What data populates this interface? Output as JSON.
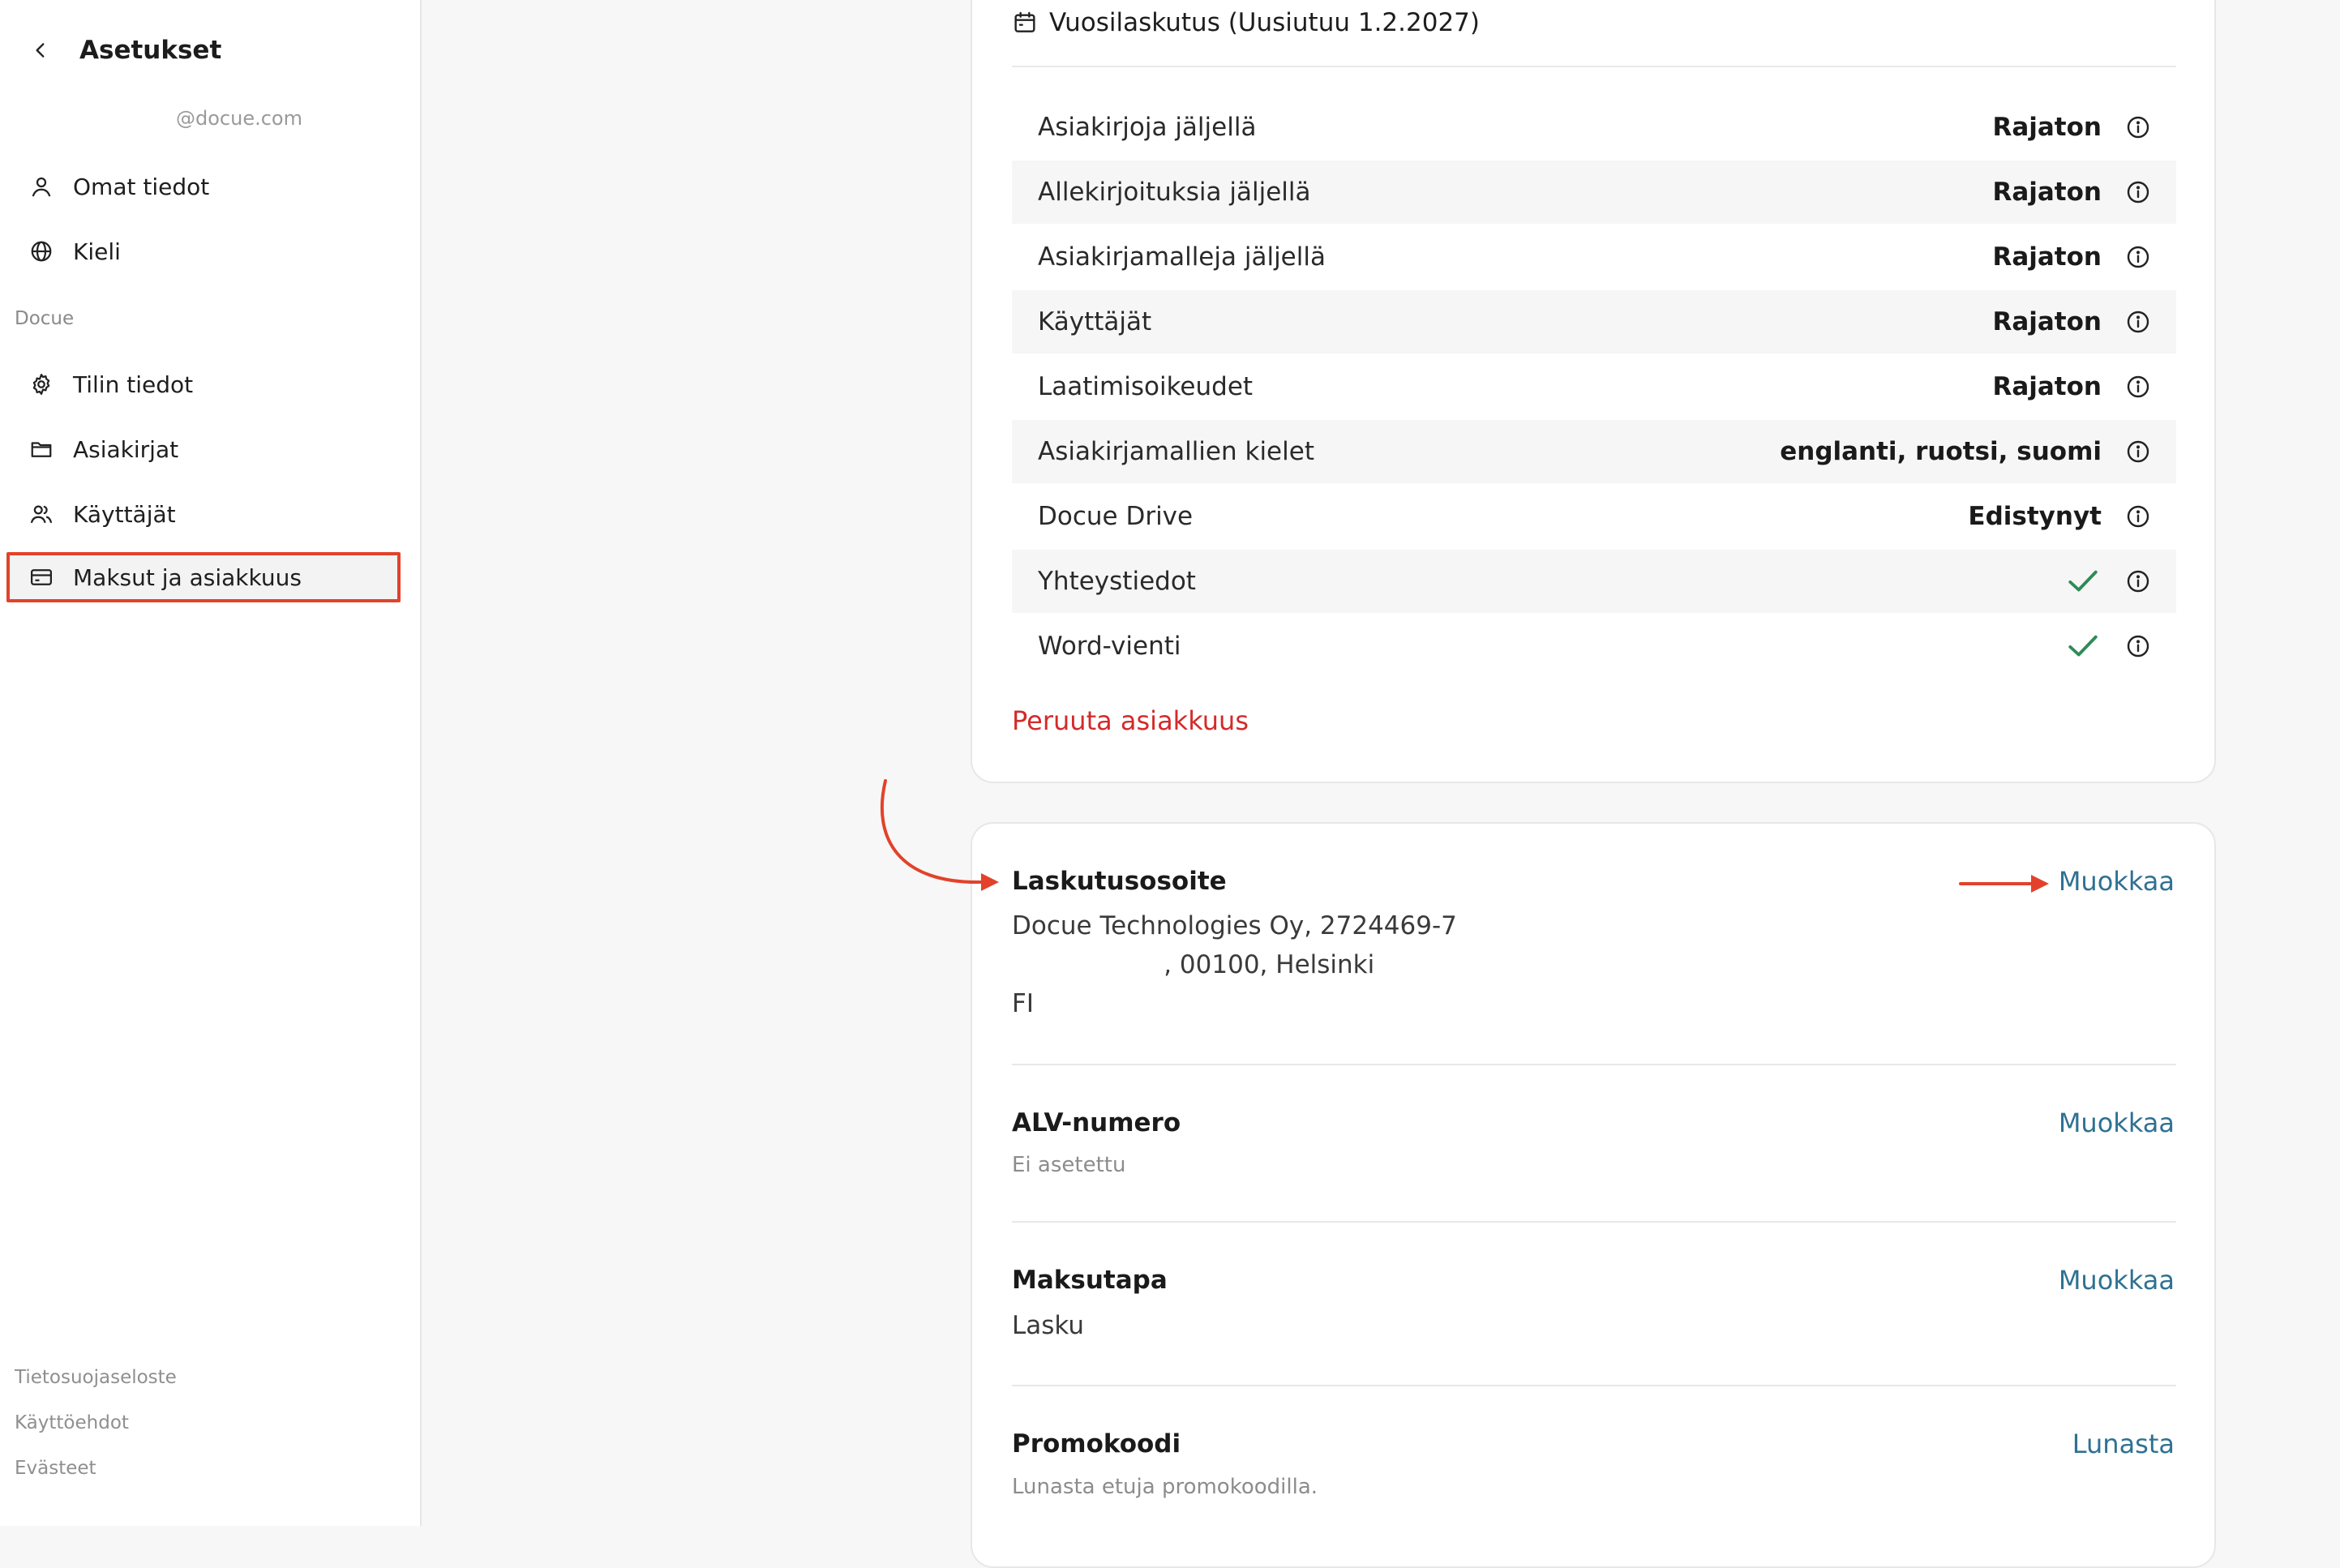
{
  "sidebar": {
    "title": "Asetukset",
    "email": "@docue.com",
    "personal_items": [
      {
        "label": "Omat tiedot",
        "icon": "user-icon"
      },
      {
        "label": "Kieli",
        "icon": "globe-icon"
      }
    ],
    "section_label": "Docue",
    "org_items": [
      {
        "label": "Tilin tiedot",
        "icon": "gear-icon"
      },
      {
        "label": "Asiakirjat",
        "icon": "folder-icon"
      },
      {
        "label": "Käyttäjät",
        "icon": "users-icon"
      },
      {
        "label": "Maksut ja asiakkuus",
        "icon": "credit-card-icon",
        "active": true
      }
    ],
    "footer_links": [
      "Tietosuojaseloste",
      "Käyttöehdot",
      "Evästeet"
    ]
  },
  "plan": {
    "billing_label": "Vuosilaskutus (Uusiutuu 1.2.2027)",
    "features": [
      {
        "name": "Asiakirjoja jäljellä",
        "value": "Rajaton"
      },
      {
        "name": "Allekirjoituksia jäljellä",
        "value": "Rajaton"
      },
      {
        "name": "Asiakirjamalleja jäljellä",
        "value": "Rajaton"
      },
      {
        "name": "Käyttäjät",
        "value": "Rajaton"
      },
      {
        "name": "Laatimisoikeudet",
        "value": "Rajaton"
      },
      {
        "name": "Asiakirjamallien kielet",
        "value": "englanti, ruotsi, suomi"
      },
      {
        "name": "Docue Drive",
        "value": "Edistynyt"
      },
      {
        "name": "Yhteystiedot",
        "value": "included"
      },
      {
        "name": "Word-vienti",
        "value": "included"
      }
    ],
    "cancel_label": "Peruuta asiakkuus"
  },
  "billing": {
    "address": {
      "title": "Laskutusosoite",
      "line1": "Docue Technologies Oy, 2724469-7",
      "line2": "                   , 00100, Helsinki",
      "line3": "FI",
      "action": "Muokkaa"
    },
    "vat": {
      "title": "ALV-numero",
      "value": "Ei asetettu",
      "action": "Muokkaa"
    },
    "payment": {
      "title": "Maksutapa",
      "value": "Lasku",
      "action": "Muokkaa"
    },
    "promo": {
      "title": "Promokoodi",
      "value": "Lunasta etuja promokoodilla.",
      "action": "Lunasta"
    }
  },
  "colors": {
    "accent_link": "#2f7193",
    "danger": "#d42a2a",
    "check": "#2e8b57",
    "annotation": "#e2422b"
  }
}
